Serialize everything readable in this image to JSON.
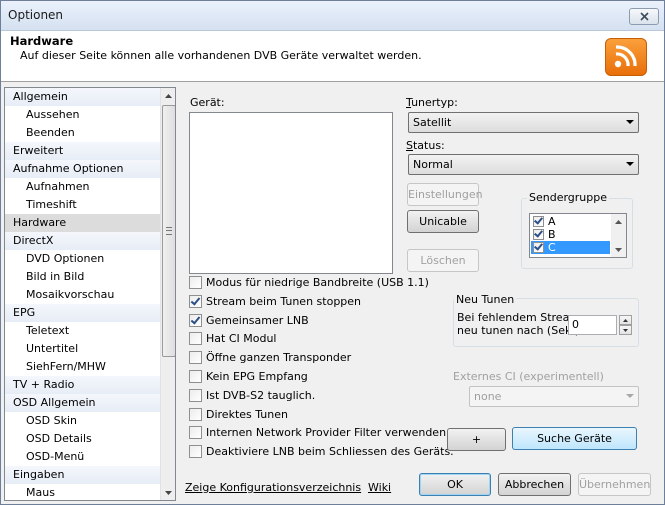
{
  "window": {
    "title": "Optionen"
  },
  "header": {
    "title": "Hardware",
    "subtitle": "Auf dieser Seite können alle vorhandenen DVB Geräte verwaltet werden.",
    "icon": "rss-feed-icon",
    "icon_color": "#f7861c"
  },
  "nav": {
    "items": [
      {
        "label": "Allgemein",
        "level": 0
      },
      {
        "label": "Aussehen",
        "level": 1
      },
      {
        "label": "Beenden",
        "level": 1
      },
      {
        "label": "Erweitert",
        "level": 0
      },
      {
        "label": "Aufnahme Optionen",
        "level": 0
      },
      {
        "label": "Aufnahmen",
        "level": 1
      },
      {
        "label": "Timeshift",
        "level": 1
      },
      {
        "label": "Hardware",
        "level": 0,
        "selected": true
      },
      {
        "label": "DirectX",
        "level": 0
      },
      {
        "label": "DVD Optionen",
        "level": 1
      },
      {
        "label": "Bild in Bild",
        "level": 1
      },
      {
        "label": "Mosaikvorschau",
        "level": 1
      },
      {
        "label": "EPG",
        "level": 0
      },
      {
        "label": "Teletext",
        "level": 1
      },
      {
        "label": "Untertitel",
        "level": 1
      },
      {
        "label": "SiehFern/MHW",
        "level": 1
      },
      {
        "label": "TV + Radio",
        "level": 0
      },
      {
        "label": "OSD Allgemein",
        "level": 0
      },
      {
        "label": "OSD Skin",
        "level": 1
      },
      {
        "label": "OSD Details",
        "level": 1
      },
      {
        "label": "OSD-Menü",
        "level": 1
      },
      {
        "label": "Eingaben",
        "level": 0
      },
      {
        "label": "Maus",
        "level": 1
      }
    ]
  },
  "device": {
    "label": "Gerät:"
  },
  "tuner": {
    "label_accel": "T",
    "label_rest": "unertyp:",
    "value": "Satellit"
  },
  "status": {
    "label_accel": "S",
    "label_rest": "tatus:",
    "value": "Normal"
  },
  "buttons": {
    "settings": "Einstellungen",
    "unicable": "Unicable",
    "delete": "Löschen",
    "add": "+",
    "search": "Suche Geräte",
    "ok": "OK",
    "cancel": "Abbrechen",
    "apply": "Übernehmen"
  },
  "sendergruppe": {
    "label": "Sendergruppe",
    "items": [
      {
        "label": "A",
        "checked": true
      },
      {
        "label": "B",
        "checked": true
      },
      {
        "label": "C",
        "checked": true,
        "selected": true
      }
    ]
  },
  "options": [
    {
      "label": "Modus für niedrige Bandbreite (USB 1.1)",
      "checked": false
    },
    {
      "label": "Stream beim Tunen stoppen",
      "checked": true
    },
    {
      "label": "Gemeinsamer LNB",
      "checked": true
    },
    {
      "label": "Hat CI Modul",
      "checked": false
    },
    {
      "label": "Öffne ganzen Transponder",
      "checked": false
    },
    {
      "label": "Kein EPG Empfang",
      "checked": false
    },
    {
      "label": "Ist DVB-S2 tauglich.",
      "checked": false
    },
    {
      "label": "Direktes Tunen",
      "checked": false
    },
    {
      "label": "Internen Network Provider Filter verwenden",
      "checked": false
    },
    {
      "label": "Deaktiviere LNB beim Schliessen des Geräts.",
      "checked": false
    }
  ],
  "retune": {
    "title": "Neu Tunen",
    "line1": "Bei fehlendem Stream",
    "line2": "neu tunen nach (Sek.)",
    "value": "0"
  },
  "external_ci": {
    "label": "Externes CI (experimentell)",
    "value": "none"
  },
  "links": {
    "config_dir": "Zeige Konfigurationsverzeichnis",
    "wiki": "Wiki"
  }
}
